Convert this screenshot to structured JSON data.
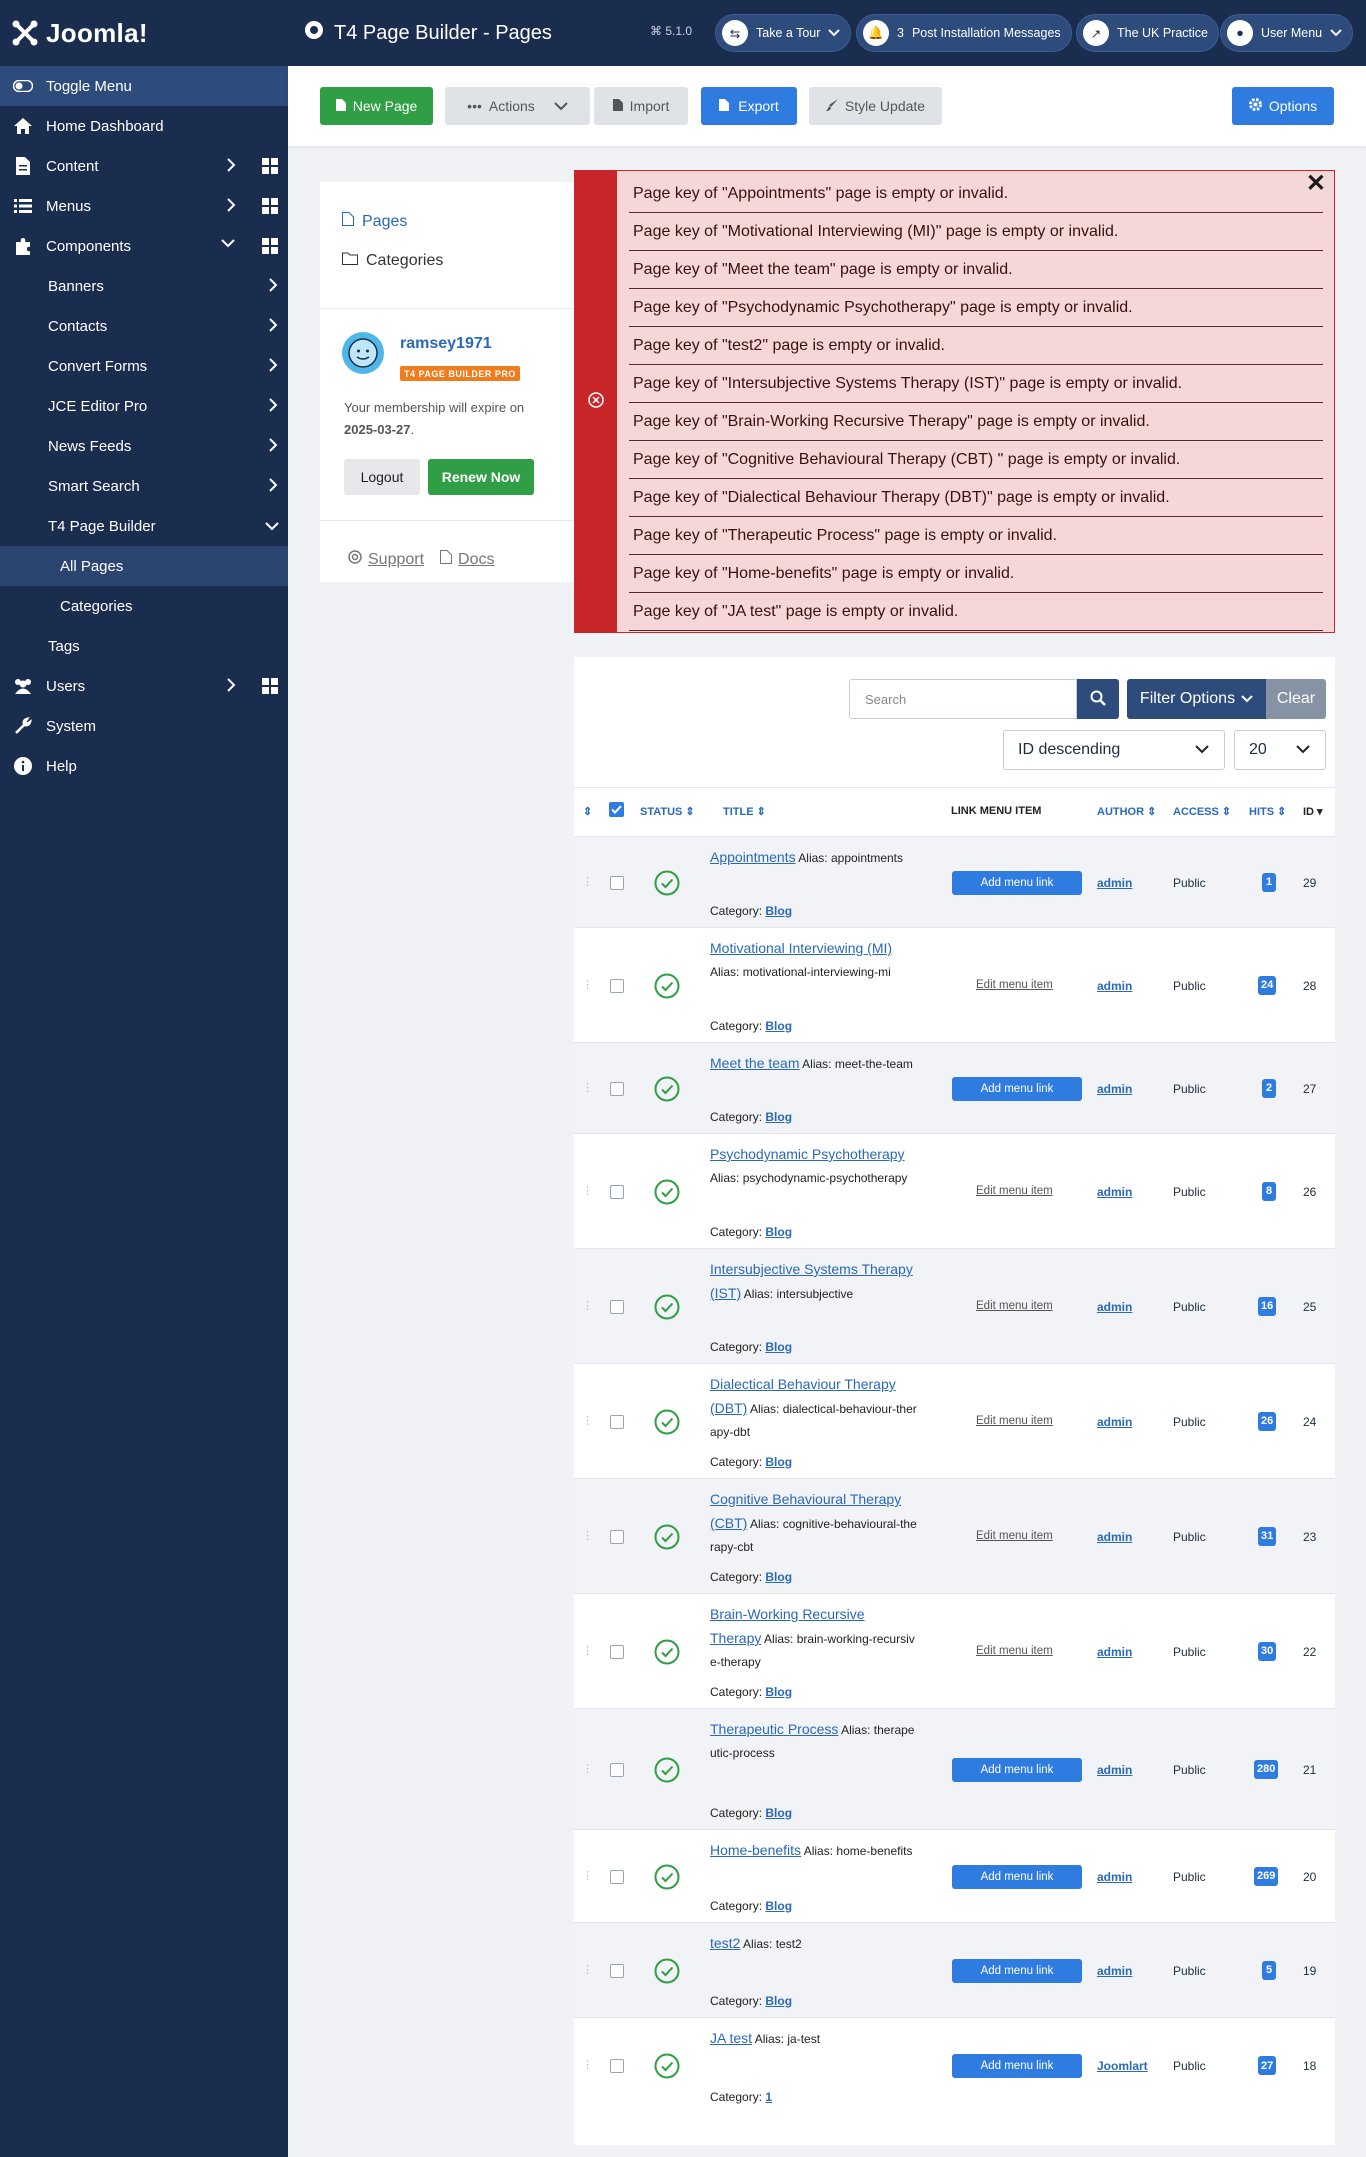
{
  "brand": {
    "logo_text": "Joomla!"
  },
  "header": {
    "title": "T4 Page Builder - Pages",
    "version": "5.1.0",
    "take_tour": "Take a Tour",
    "notif_count": "3",
    "post_install": "Post Installation Messages",
    "site_name": "The UK Practice",
    "user_menu": "User Menu"
  },
  "sidebar": {
    "toggle": "Toggle Menu",
    "home": "Home Dashboard",
    "content": "Content",
    "menus": "Menus",
    "components": "Components",
    "banners": "Banners",
    "contacts": "Contacts",
    "convert_forms": "Convert Forms",
    "jce": "JCE Editor Pro",
    "news_feeds": "News Feeds",
    "smart_search": "Smart Search",
    "t4": "T4 Page Builder",
    "all_pages": "All Pages",
    "categories": "Categories",
    "tags": "Tags",
    "users": "Users",
    "system": "System",
    "help": "Help"
  },
  "toolbar": {
    "new_page": "New Page",
    "actions": "Actions",
    "import": "Import",
    "export": "Export",
    "style_update": "Style Update",
    "options": "Options"
  },
  "panel": {
    "pages": "Pages",
    "categories": "Categories",
    "username": "ramsey1971",
    "badge": "T4 PAGE BUILDER PRO",
    "membership": "Your membership will expire on",
    "expiry": "2025-03-27",
    "logout": "Logout",
    "renew": "Renew Now",
    "support": "Support",
    "docs": "Docs"
  },
  "alerts": [
    "Page key of \"Appointments\" page is empty or invalid.",
    "Page key of \"Motivational Interviewing (MI)\" page is empty or invalid.",
    "Page key of \"Meet the team\" page is empty or invalid.",
    "Page key of \"Psychodynamic Psychotherapy\" page is empty or invalid.",
    "Page key of \"test2\" page is empty or invalid.",
    "Page key of \"Intersubjective Systems Therapy (IST)\" page is empty or invalid.",
    "Page key of \"Brain-Working Recursive Therapy\" page is empty or invalid.",
    "Page key of \"Cognitive Behavioural Therapy (CBT) \" page is empty or invalid.",
    "Page key of \"Dialectical Behaviour Therapy (DBT)\" page is empty or invalid.",
    "Page key of \"Therapeutic Process\" page is empty or invalid.",
    "Page key of \"Home-benefits\" page is empty or invalid.",
    "Page key of \"JA test\" page is empty or invalid."
  ],
  "filters": {
    "search_placeholder": "Search",
    "filter_options": "Filter Options",
    "clear": "Clear",
    "ordering": "ID descending",
    "limit": "20"
  },
  "columns": {
    "status": "STATUS",
    "title": "TITLE",
    "link_menu": "LINK MENU ITEM",
    "author": "AUTHOR",
    "access": "ACCESS",
    "hits": "HITS",
    "id": "ID"
  },
  "alias_prefix": "Alias:",
  "category_prefix": "Category:",
  "rows": [
    {
      "title": "Appointments",
      "alias": "appointments",
      "category": "Blog",
      "menu": "Add menu link",
      "menu_type": "add",
      "author": "admin",
      "access": "Public",
      "hits": "1",
      "id": "29"
    },
    {
      "title": "Motivational Interviewing (MI)",
      "alias": "motivational-interviewing-mi",
      "category": "Blog",
      "menu": "Edit menu item",
      "menu_type": "edit",
      "author": "admin",
      "access": "Public",
      "hits": "24",
      "id": "28"
    },
    {
      "title": "Meet the team",
      "alias": "meet-the-team",
      "category": "Blog",
      "menu": "Add menu link",
      "menu_type": "add",
      "author": "admin",
      "access": "Public",
      "hits": "2",
      "id": "27"
    },
    {
      "title": "Psychodynamic Psychotherapy",
      "alias": "psychodynamic-psychotherapy",
      "category": "Blog",
      "menu": "Edit menu item",
      "menu_type": "edit",
      "author": "admin",
      "access": "Public",
      "hits": "8",
      "id": "26"
    },
    {
      "title": "Intersubjective Systems Therapy (IST)",
      "alias": "intersubjective",
      "category": "Blog",
      "menu": "Edit menu item",
      "menu_type": "edit",
      "author": "admin",
      "access": "Public",
      "hits": "16",
      "id": "25"
    },
    {
      "title": "Dialectical Behaviour Therapy (DBT)",
      "alias": "dialectical-behaviour-therapy-dbt",
      "category": "Blog",
      "menu": "Edit menu item",
      "menu_type": "edit",
      "author": "admin",
      "access": "Public",
      "hits": "26",
      "id": "24"
    },
    {
      "title": "Cognitive Behavioural Therapy (CBT)",
      "alias": "cognitive-behavioural-therapy-cbt",
      "category": "Blog",
      "menu": "Edit menu item",
      "menu_type": "edit",
      "author": "admin",
      "access": "Public",
      "hits": "31",
      "id": "23"
    },
    {
      "title": "Brain-Working Recursive Therapy",
      "alias": "brain-working-recursive-therapy",
      "category": "Blog",
      "menu": "Edit menu item",
      "menu_type": "edit",
      "author": "admin",
      "access": "Public",
      "hits": "30",
      "id": "22"
    },
    {
      "title": "Therapeutic Process",
      "alias": "therapeutic-process",
      "category": "Blog",
      "menu": "Add menu link",
      "menu_type": "add",
      "author": "admin",
      "access": "Public",
      "hits": "280",
      "id": "21"
    },
    {
      "title": "Home-benefits",
      "alias": "home-benefits",
      "category": "Blog",
      "menu": "Add menu link",
      "menu_type": "add",
      "author": "admin",
      "access": "Public",
      "hits": "269",
      "id": "20"
    },
    {
      "title": "test2",
      "alias": "test2",
      "category": "Blog",
      "menu": "Add menu link",
      "menu_type": "add",
      "author": "admin",
      "access": "Public",
      "hits": "5",
      "id": "19"
    },
    {
      "title": "JA test",
      "alias": "ja-test",
      "category": "1",
      "menu": "Add menu link",
      "menu_type": "add",
      "author": "Joomlart",
      "access": "Public",
      "hits": "27",
      "id": "18"
    }
  ]
}
